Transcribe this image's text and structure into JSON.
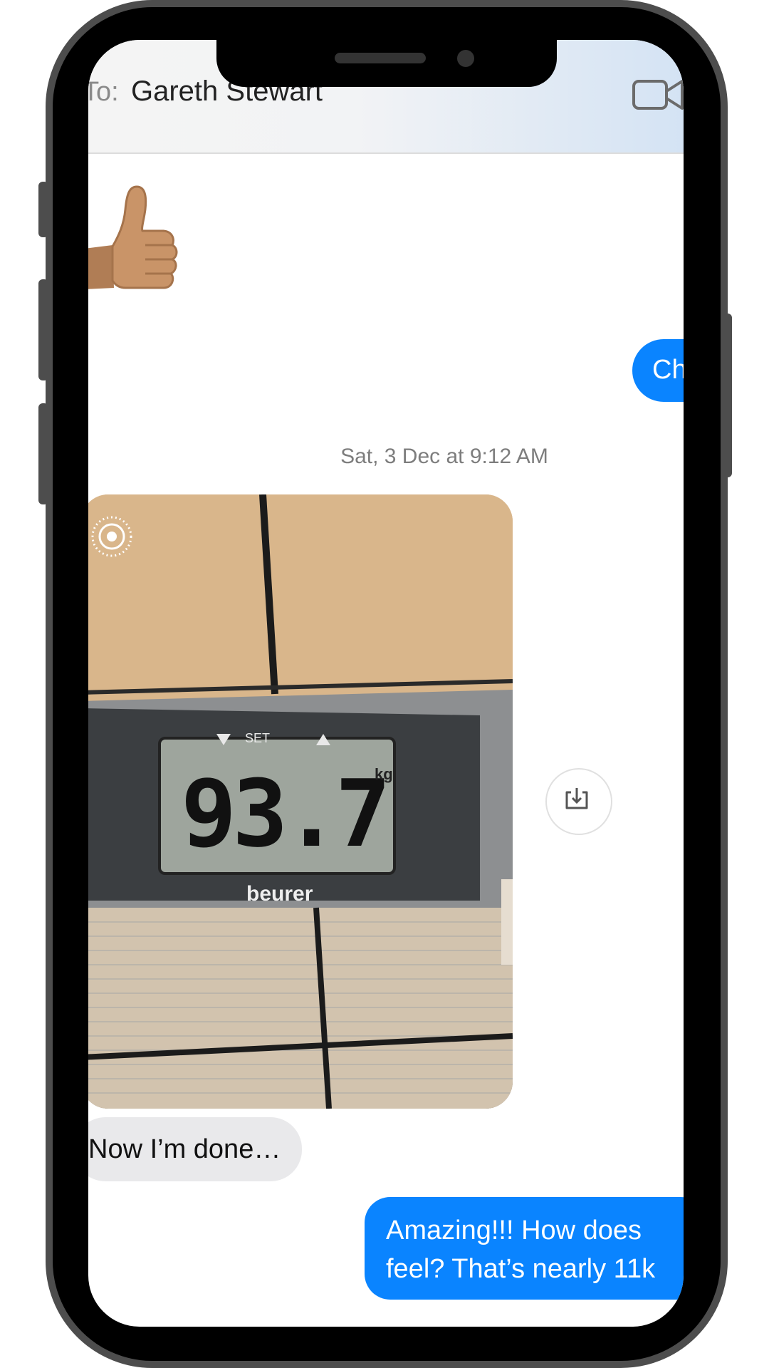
{
  "header": {
    "to_label": "To:",
    "recipient": "Gareth Stewart",
    "video_icon": "video-camera-icon"
  },
  "messages": {
    "sticker_icon": "thumbs-up-icon",
    "outgoing_partial": "Ch",
    "timestamp": "Sat, 3 Dec at 9:12 AM",
    "photo": {
      "scale_brand": "beurer",
      "scale_label": "SET",
      "weight_reading": "93.7",
      "weight_unit": "kg",
      "live_icon": "live-photo-icon",
      "save_icon": "download-icon"
    },
    "incoming_text": "Now I’m done…",
    "outgoing_line1": "Amazing!!! How does",
    "outgoing_line2": "feel? That’s nearly 11k"
  },
  "colors": {
    "imessage_blue": "#0a84ff",
    "incoming_gray": "#e9e9eb"
  }
}
